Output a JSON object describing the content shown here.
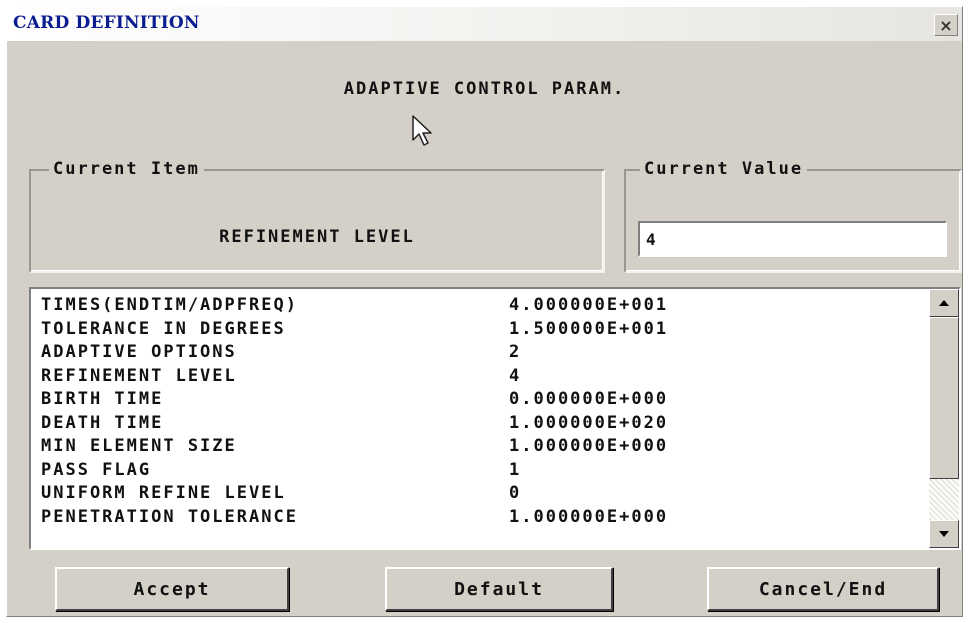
{
  "window": {
    "title": "CARD DEFINITION",
    "close_glyph": "×"
  },
  "heading": "ADAPTIVE CONTROL PARAM.",
  "current_item": {
    "label": "Current Item",
    "name": "REFINEMENT LEVEL"
  },
  "current_value": {
    "label": "Current Value",
    "value": "4"
  },
  "list": {
    "rows": [
      {
        "name": "TIMES(ENDTIM/ADPFREQ)",
        "value": "4.000000E+001"
      },
      {
        "name": "TOLERANCE IN DEGREES",
        "value": "1.500000E+001"
      },
      {
        "name": "ADAPTIVE OPTIONS",
        "value": "2"
      },
      {
        "name": "REFINEMENT LEVEL",
        "value": "4"
      },
      {
        "name": "BIRTH TIME",
        "value": "0.000000E+000"
      },
      {
        "name": "DEATH TIME",
        "value": "1.000000E+020"
      },
      {
        "name": "MIN ELEMENT SIZE",
        "value": "1.000000E+000"
      },
      {
        "name": "PASS FLAG",
        "value": "1"
      },
      {
        "name": "UNIFORM REFINE LEVEL",
        "value": "0"
      },
      {
        "name": "PENETRATION TOLERANCE",
        "value": "1.000000E+000"
      }
    ]
  },
  "buttons": {
    "accept": "Accept",
    "default": "Default",
    "cancel": "Cancel/End"
  },
  "icons": {
    "cursor": "mouse-pointer-icon",
    "scroll_up": "scroll-up-arrow-icon",
    "scroll_down": "scroll-down-arrow-icon",
    "close": "close-icon"
  }
}
